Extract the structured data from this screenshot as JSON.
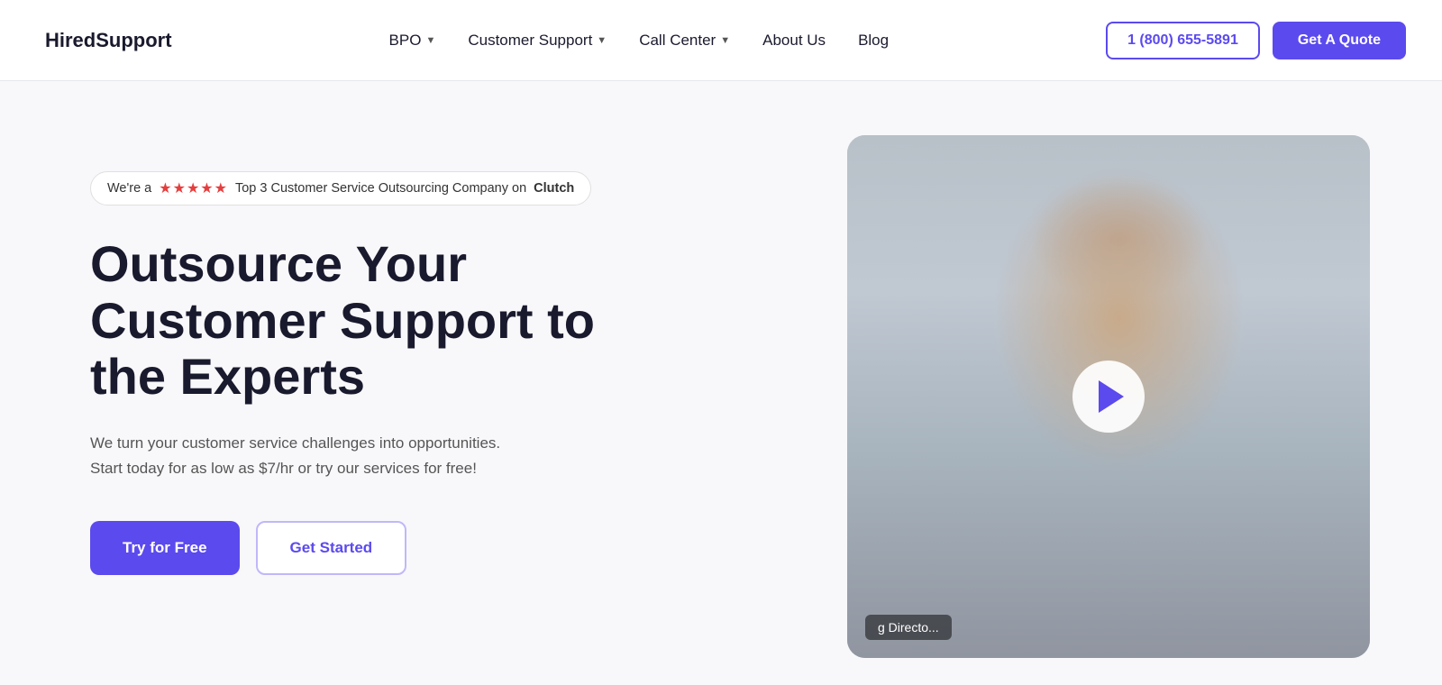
{
  "logo": {
    "text": "HiredSupport",
    "icon": "chat-icon"
  },
  "nav": {
    "links": [
      {
        "label": "BPO",
        "hasDropdown": true
      },
      {
        "label": "Customer Support",
        "hasDropdown": true
      },
      {
        "label": "Call Center",
        "hasDropdown": true
      },
      {
        "label": "About Us",
        "hasDropdown": false
      },
      {
        "label": "Blog",
        "hasDropdown": false
      }
    ],
    "phone": "1 (800) 655-5891",
    "cta": "Get A Quote"
  },
  "hero": {
    "badge": {
      "prefix": "We're a",
      "stars": "★★★★★",
      "suffix": "Top 3 Customer Service Outsourcing Company on",
      "brand": "Clutch"
    },
    "title": "Outsource Your Customer Support to the Experts",
    "subtitle": "We turn your customer service challenges into opportunities. Start today for as low as $7/hr or try our services for free!",
    "btn_try": "Try for Free",
    "btn_start": "Get Started"
  },
  "video": {
    "caption": "g Directo...",
    "play_label": "Play video"
  }
}
